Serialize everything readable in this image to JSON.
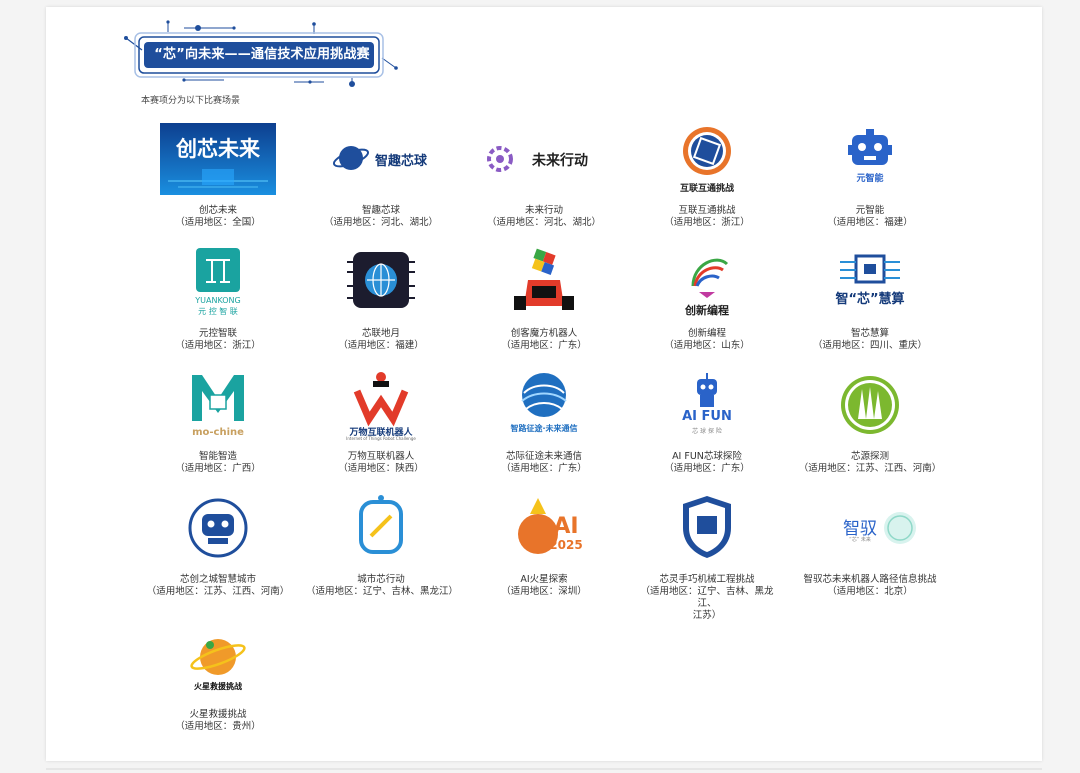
{
  "banner": {
    "title": "“芯”向未来——通信技术应用挑战赛"
  },
  "subtitle": "本赛项分为以下比赛场景",
  "logo_texts": {
    "l1": "创芯未来",
    "l2": "智趣芯球",
    "l3": "未来行动",
    "l4": "互联互通挑战",
    "l5": "元智能",
    "l6a": "YUANKONG",
    "l6b": "元 控 智 联",
    "l9": "创新编程",
    "l10": "智“芯”慧算",
    "l11": "mo-chine",
    "l12a": "万物互联机器人",
    "l12b": "Internet of Things Robot Challenge",
    "l13": "智路征途·未来通信",
    "l14a": "AI FUN",
    "l14b": "芯 球 探 险",
    "l19a": "智驭",
    "l19b": "“芯” 未来",
    "l18": "AI",
    "l18b": "2025",
    "l21": "火星救援挑战"
  },
  "items": [
    {
      "name": "创芯未来",
      "region": "（适用地区：全国）"
    },
    {
      "name": "智趣芯球",
      "region": "（适用地区：河北、湖北）"
    },
    {
      "name": "未来行动",
      "region": "（适用地区：河北、湖北）"
    },
    {
      "name": "互联互通挑战",
      "region": "（适用地区：浙江）"
    },
    {
      "name": "元智能",
      "region": "（适用地区：福建）"
    },
    {
      "name": "元控智联",
      "region": "（适用地区：浙江）"
    },
    {
      "name": "芯联地月",
      "region": "（适用地区：福建）"
    },
    {
      "name": "创客魔方机器人",
      "region": "（适用地区：广东）"
    },
    {
      "name": "创新编程",
      "region": "（适用地区：山东）"
    },
    {
      "name": "智芯慧算",
      "region": "（适用地区：四川、重庆）"
    },
    {
      "name": "智能智造",
      "region": "（适用地区：广西）"
    },
    {
      "name": "万物互联机器人",
      "region": "（适用地区：陕西）"
    },
    {
      "name": "芯际征途未来通信",
      "region": "（适用地区：广东）"
    },
    {
      "name": "AI FUN芯球探险",
      "region": "（适用地区：广东）"
    },
    {
      "name": "芯源探测",
      "region": "（适用地区：江苏、江西、河南）"
    },
    {
      "name": "芯创之城智慧城市",
      "region": "（适用地区：江苏、江西、河南）"
    },
    {
      "name": "城市芯行动",
      "region": "（适用地区：辽宁、吉林、黑龙江）"
    },
    {
      "name": "AI火星探索",
      "region": "（适用地区：深圳）"
    },
    {
      "name": "芯灵手巧机械工程挑战",
      "region": "（适用地区：辽宁、吉林、黑龙江、",
      "region2": "江苏）"
    },
    {
      "name": "智驭芯未来机器人路径信息挑战",
      "region": "（适用地区：北京）"
    },
    {
      "name": "火星救援挑战",
      "region": "（适用地区：贵州）"
    }
  ],
  "colors": {
    "primary_blue": "#1f4e9c",
    "dark_navy": "#143a7a",
    "accent_orange": "#e8742a",
    "green": "#7cb82f",
    "teal": "#1aa3a0"
  }
}
